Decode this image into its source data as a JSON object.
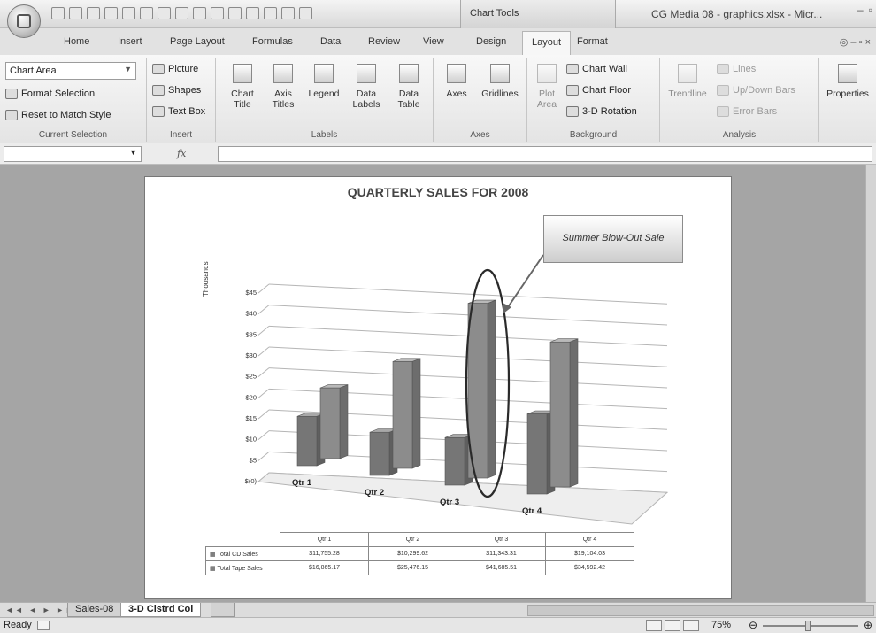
{
  "app": {
    "chart_tools_label": "Chart Tools",
    "doc_title": "CG Media 08 - graphics.xlsx - Micr..."
  },
  "tabs": [
    "Home",
    "Insert",
    "Page Layout",
    "Formulas",
    "Data",
    "Review",
    "View",
    "Design",
    "Layout",
    "Format"
  ],
  "active_tab": "Layout",
  "ribbon": {
    "current_selection": {
      "value": "Chart Area",
      "format_selection": "Format Selection",
      "reset": "Reset to Match Style",
      "label": "Current Selection"
    },
    "insert": {
      "picture": "Picture",
      "shapes": "Shapes",
      "text_box": "Text Box",
      "label": "Insert"
    },
    "labels": {
      "chart_title": [
        "Chart",
        "Title"
      ],
      "axis_titles": [
        "Axis",
        "Titles"
      ],
      "legend": [
        "Legend",
        ""
      ],
      "data_labels": [
        "Data",
        "Labels"
      ],
      "data_table": [
        "Data",
        "Table"
      ],
      "label": "Labels"
    },
    "axes": {
      "axes": "Axes",
      "gridlines": "Gridlines",
      "label": "Axes"
    },
    "background": {
      "plot_area": [
        "Plot",
        "Area"
      ],
      "chart_wall": "Chart Wall",
      "chart_floor": "Chart Floor",
      "rotation": "3-D Rotation",
      "label": "Background"
    },
    "analysis": {
      "trendline": "Trendline",
      "lines": "Lines",
      "updown": "Up/Down Bars",
      "errorbars": "Error Bars",
      "label": "Analysis"
    },
    "properties": "Properties"
  },
  "formula_bar": {
    "fx": "fx",
    "value": ""
  },
  "chart": {
    "title": "QUARTERLY SALES FOR 2008",
    "callout": "Summer Blow-Out  Sale",
    "ylabel": "Thousands"
  },
  "chart_data": {
    "type": "bar",
    "title": "QUARTERLY SALES FOR 2008",
    "ylabel": "Thousands",
    "categories": [
      "Qtr 1",
      "Qtr 2",
      "Qtr 3",
      "Qtr 4"
    ],
    "yticks": [
      "$(0)",
      "$5",
      "$10",
      "$15",
      "$20",
      "$25",
      "$30",
      "$35",
      "$40",
      "$45"
    ],
    "ylim": [
      0,
      45
    ],
    "series": [
      {
        "name": "Total CD Sales",
        "values": [
          11.76,
          10.3,
          11.34,
          19.1
        ],
        "display": [
          "$11,755.28",
          "$10,299.62",
          "$11,343.31",
          "$19,104.03"
        ]
      },
      {
        "name": "Total Tape Sales",
        "values": [
          16.87,
          25.48,
          41.69,
          34.59
        ],
        "display": [
          "$16,865.17",
          "$25,476.15",
          "$41,685.51",
          "$34,592.42"
        ]
      }
    ],
    "colors": [
      "#7a7a7a",
      "#8f8f8f"
    ]
  },
  "sheet_tabs": [
    "Sales-08",
    "3-D Clstrd Col"
  ],
  "active_sheet": "3-D Clstrd Col",
  "status": {
    "text": "Ready",
    "zoom": "75%"
  }
}
